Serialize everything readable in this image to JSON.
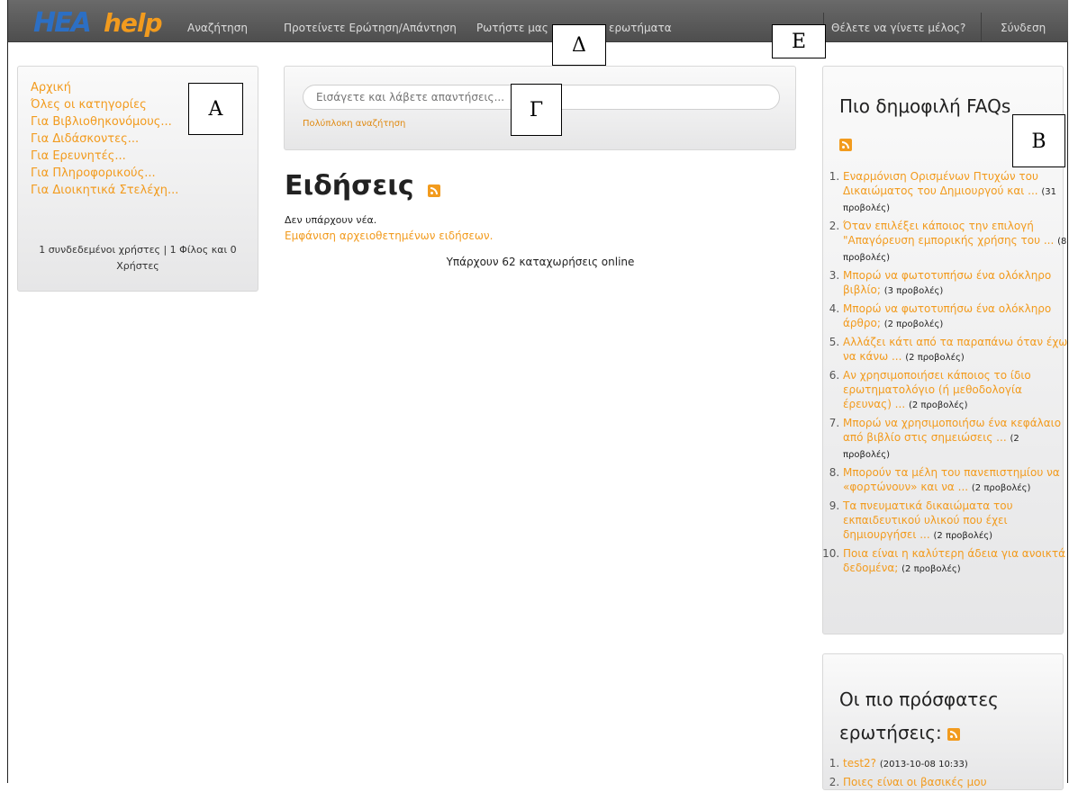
{
  "nav": {
    "logo_hea": "HEA",
    "logo_help": "help",
    "items": [
      "Αναζήτηση",
      "Προτείνετε Ερώτηση/Απάντηση",
      "Ρωτήστε μας",
      "ερωτήματα"
    ],
    "right": [
      "Θέλετε να γίνετε μέλος?",
      "Σύνδεση"
    ]
  },
  "labels": {
    "A": "Α",
    "B": "Β",
    "G": "Γ",
    "D": "Δ",
    "E": "Ε"
  },
  "left_menu": {
    "items": [
      "Αρχική",
      "Όλες οι κατηγορίες",
      "Για Βιβλιοθηκονόμους...",
      "Για Διδάσκοντες...",
      "Για Ερευνητές...",
      "Για Πληροφορικούς...",
      "Για Διοικητικά Στελέχη..."
    ],
    "online_line1": "1 συνδεδεμένοι χρήστες | 1 Φίλος και 0",
    "online_line2": "Χρήστες"
  },
  "search": {
    "placeholder": "Εισάγετε και λάβετε απαντήσεις...",
    "advanced": "Πολύπλοκη αναζήτηση"
  },
  "news": {
    "title": "Ειδήσεις",
    "empty": "Δεν υπάρχουν νέα.",
    "archived": "Εμφάνιση αρχειοθετημένων ειδήσεων.",
    "entries_online": "Υπάρχουν 62 καταχωρήσεις online"
  },
  "popular": {
    "title": "Πιο δημοφιλή FAQs",
    "items": [
      {
        "text": "Εναρμόνιση Ορισμένων Πτυχών του Δικαιώματος του Δημιουργού και ...",
        "views": "(31 προβολές)"
      },
      {
        "text": "Όταν επιλέξει κάποιος την επιλογή \"Απαγόρευση εμπορικής χρήσης του ...",
        "views": "(8 προβολές)"
      },
      {
        "text": "Μπορώ να φωτοτυπήσω ένα ολόκληρο βιβλίο;",
        "views": "(3 προβολές)"
      },
      {
        "text": "Μπορώ να φωτοτυπήσω ένα ολόκληρο άρθρο;",
        "views": "(2 προβολές)"
      },
      {
        "text": "Αλλάζει κάτι από τα παραπάνω όταν έχω να κάνω ...",
        "views": "(2 προβολές)"
      },
      {
        "text": "Αν χρησιμοποιήσει κάποιος το ίδιο ερωτηματολόγιο (ή μεθοδολογία έρευνας) ...",
        "views": "(2 προβολές)"
      },
      {
        "text": "Μπορώ να χρησιμοποιήσω ένα κεφάλαιο από βιβλίο στις σημειώσεις ...",
        "views": "(2 προβολές)"
      },
      {
        "text": "Μπορούν τα μέλη του πανεπιστημίου να «φορτώνουν» και να ...",
        "views": "(2 προβολές)"
      },
      {
        "text": "Τα πνευματικά δικαιώματα του εκπαιδευτικού υλικού που έχει δημιουργήσει ...",
        "views": "(2 προβολές)"
      },
      {
        "text": "Ποια είναι η καλύτερη άδεια για ανοικτά δεδομένα;",
        "views": "(2 προβολές)"
      }
    ]
  },
  "recent": {
    "title_line1": "Οι πιο πρόσφατες",
    "title_line2": "ερωτήσεις:",
    "items": [
      {
        "text": "test2?",
        "date": "(2013-10-08 10:33)"
      },
      {
        "text": "Ποιες είναι οι βασικές μου",
        "date": ""
      }
    ]
  },
  "colors": {
    "accent": "#f29b1e",
    "topbar": "#5a5a5a"
  }
}
